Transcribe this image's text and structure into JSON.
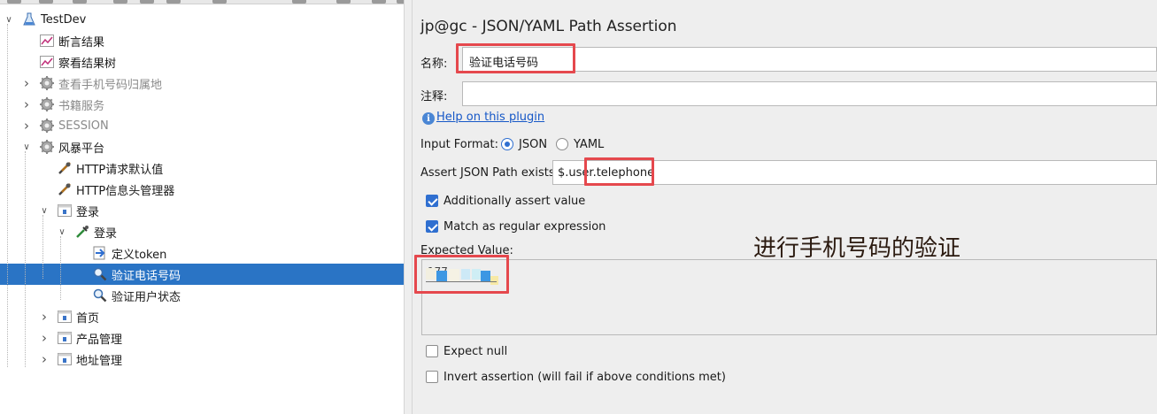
{
  "tree": {
    "items": [
      {
        "label": "TestDev",
        "depth": 0,
        "icon": "flask-icon",
        "expanded": true
      },
      {
        "label": "断言结果",
        "depth": 1,
        "icon": "graph-icon"
      },
      {
        "label": "察看结果树",
        "depth": 1,
        "icon": "graph-icon"
      },
      {
        "label": "查看手机号码归属地",
        "depth": 1,
        "icon": "gear-icon",
        "disabled": true,
        "collapsed": true
      },
      {
        "label": "书籍服务",
        "depth": 1,
        "icon": "gear-icon",
        "disabled": true,
        "collapsed": true
      },
      {
        "label": "SESSION",
        "depth": 1,
        "icon": "gear-icon",
        "disabled": true,
        "collapsed": true
      },
      {
        "label": "风暴平台",
        "depth": 1,
        "icon": "gear-icon",
        "expanded": true
      },
      {
        "label": "HTTP请求默认值",
        "depth": 2,
        "icon": "wrench-icon"
      },
      {
        "label": "HTTP信息头管理器",
        "depth": 2,
        "icon": "wrench-icon"
      },
      {
        "label": "登录",
        "depth": 2,
        "icon": "controller-icon",
        "expanded": true
      },
      {
        "label": "登录",
        "depth": 3,
        "icon": "sampler-icon",
        "expanded": true
      },
      {
        "label": "定义token",
        "depth": 4,
        "icon": "extractor-icon"
      },
      {
        "label": "验证电话号码",
        "depth": 4,
        "icon": "magnifier-icon",
        "selected": true
      },
      {
        "label": "验证用户状态",
        "depth": 4,
        "icon": "magnifier-icon"
      },
      {
        "label": "首页",
        "depth": 2,
        "icon": "controller-icon",
        "collapsed": true
      },
      {
        "label": "产品管理",
        "depth": 2,
        "icon": "controller-icon",
        "collapsed": true
      },
      {
        "label": "地址管理",
        "depth": 2,
        "icon": "controller-icon",
        "collapsed": true
      }
    ]
  },
  "panel": {
    "title": "jp@gc - JSON/YAML Path Assertion",
    "name_label": "名称:",
    "name_value": "验证电话号码",
    "comment_label": "注释:",
    "comment_value": "",
    "help_link": "Help on this plugin",
    "input_format_label": "Input Format:",
    "format_json": "JSON",
    "format_yaml": "YAML",
    "format_selected": "JSON",
    "path_label": "Assert JSON Path exists:",
    "path_value": "$.user.telephone",
    "additionally_assert": "Additionally assert value",
    "additionally_checked": true,
    "regex_label": "Match as regular expression",
    "regex_checked": true,
    "expected_label": "Expected Value:",
    "expected_value_visible": "177",
    "expect_null": "Expect null",
    "expect_null_checked": false,
    "invert_label": "Invert assertion (will fail if above conditions met)",
    "invert_checked": false
  },
  "annotation": {
    "text": "进行手机号码的验证",
    "highlight_color": "#e5484d"
  },
  "colors": {
    "selection": "#2a74c5",
    "link": "#1557c7",
    "panel_bg": "#eeeeee"
  }
}
